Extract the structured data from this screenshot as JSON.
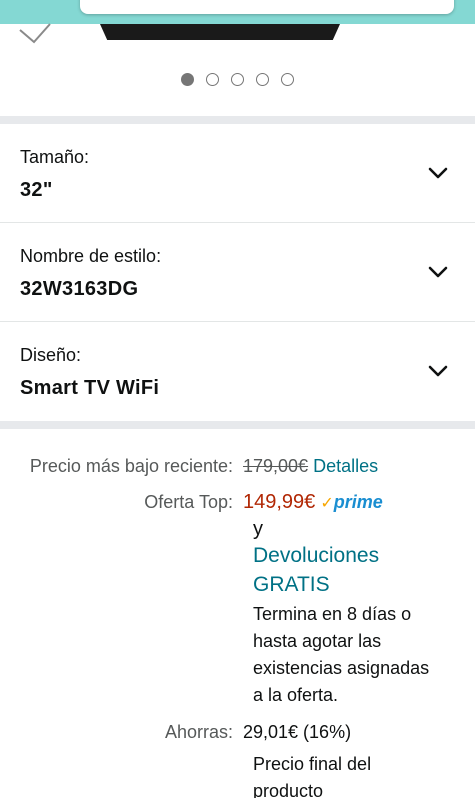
{
  "carousel": {
    "count": 5,
    "active_index": 0
  },
  "variations": [
    {
      "label": "Tamaño:",
      "value": "32\""
    },
    {
      "label": "Nombre de estilo:",
      "value": "32W3163DG"
    },
    {
      "label": "Diseño:",
      "value": "Smart TV WiFi"
    }
  ],
  "pricing": {
    "recent_low_label": "Precio más bajo reciente:",
    "recent_low_price": "179,00€",
    "details_link": "Detalles",
    "deal_label": "Oferta Top:",
    "deal_price": "149,99€",
    "prime_check": "✓",
    "prime_text": "prime",
    "and_text": "y",
    "returns_line1": "Devoluciones",
    "returns_line2": "GRATIS",
    "deal_ends_lines": [
      "Termina en 8 días o",
      "hasta agotar las",
      "existencias asignadas",
      "a la oferta."
    ],
    "savings_label": "Ahorras:",
    "savings_value": "29,01€ (16%)",
    "final_price_lines": [
      "Precio final del",
      "producto"
    ]
  },
  "colors": {
    "link": "#007185",
    "deal_price": "#b12704",
    "prime_blue": "#1a8ed1",
    "prime_check": "#f7a600",
    "separator": "#e7e9ec"
  }
}
